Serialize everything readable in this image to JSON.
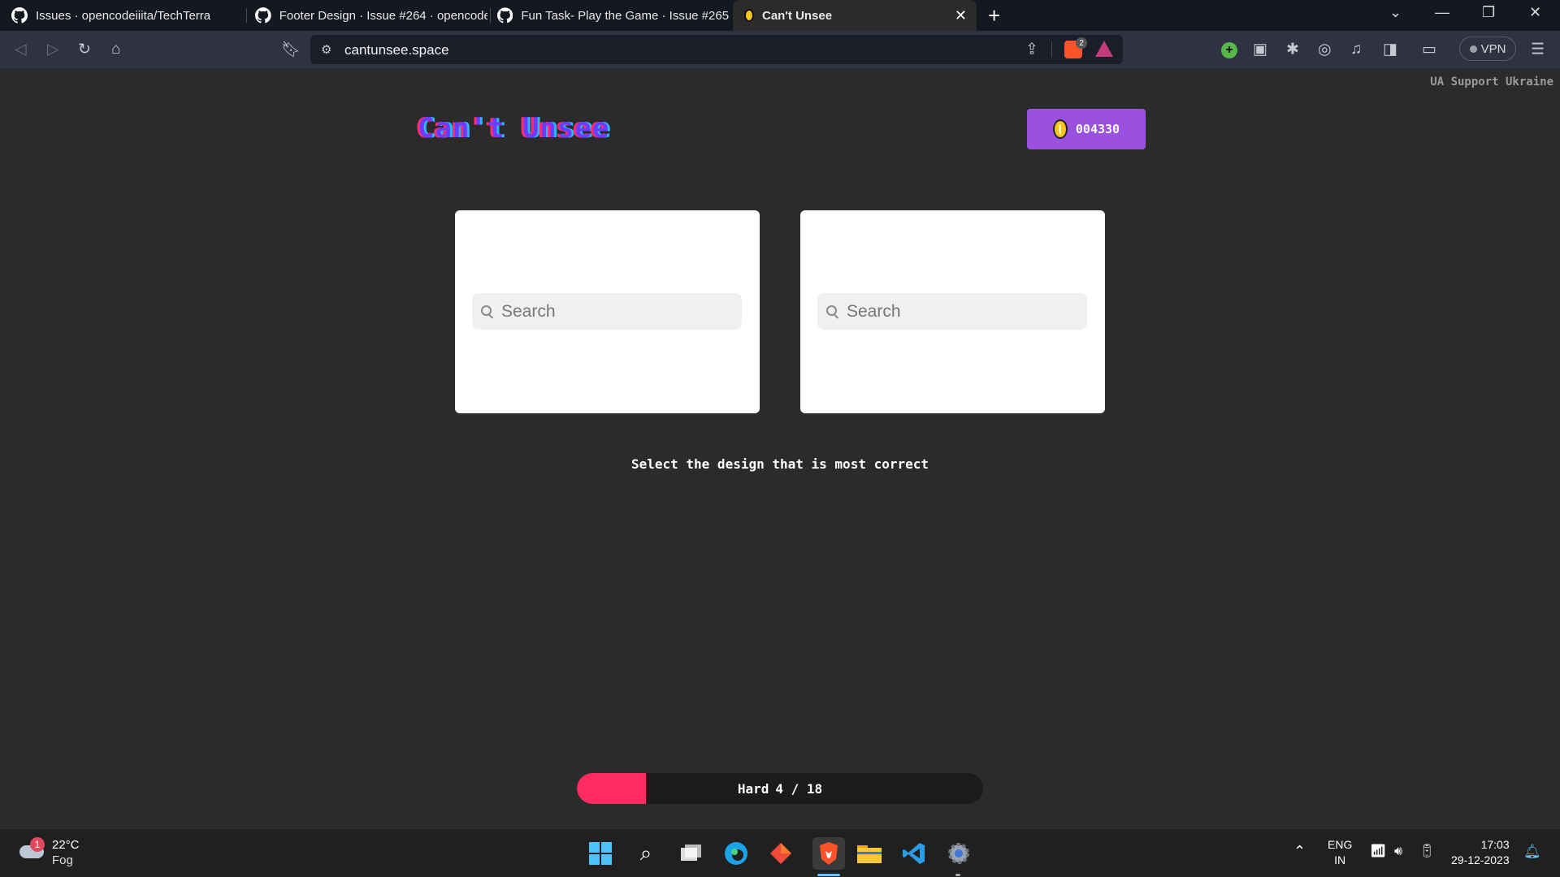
{
  "browser": {
    "tabs": [
      {
        "title": "Issues · opencodeiiita/TechTerra",
        "icon": "github-icon"
      },
      {
        "title": "Footer Design · Issue #264 · opencode",
        "icon": "github-icon"
      },
      {
        "title": "Fun Task- Play the Game · Issue #265 ·",
        "icon": "github-icon"
      },
      {
        "title": "Can't Unsee",
        "icon": "coin-icon",
        "active": true
      }
    ],
    "url": "cantunsee.space",
    "shields_count": "2",
    "vpn_label": "VPN"
  },
  "page": {
    "support_text": "UA Support Ukraine",
    "logo": "Can't Unsee",
    "coins": "004330",
    "search_placeholder_left": "Search",
    "search_placeholder_right": "Search",
    "prompt": "Select the design that is most correct",
    "progress": {
      "difficulty": "Hard",
      "label": "4 / 18",
      "fraction": 0.17
    }
  },
  "taskbar": {
    "weather_temp": "22°C",
    "weather_desc": "Fog",
    "weather_badge": "1",
    "lang_top": "ENG",
    "lang_bottom": "IN",
    "time": "17:03",
    "date": "29-12-2023"
  },
  "colors": {
    "accent_purple": "#9b51e0",
    "progress_fill": "#ff2a5f",
    "page_bg": "#2b2b2b"
  }
}
